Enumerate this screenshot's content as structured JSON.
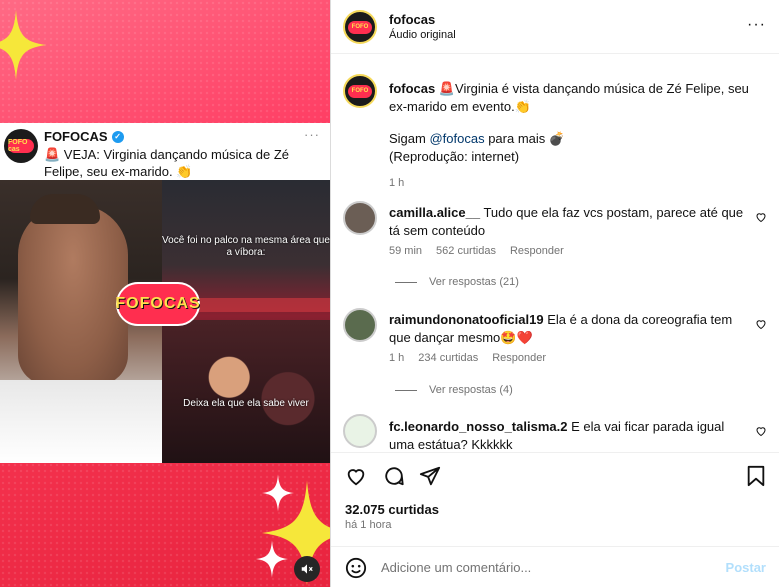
{
  "media": {
    "card": {
      "name": "FOFOCAS",
      "text": "🚨 VEJA: Virginia dançando música de Zé Felipe, seu ex-marido. 👏",
      "more": "···",
      "logo_text": "FOFO cas"
    },
    "overlay_top": "Você foi no palco na mesma área que a víbora:",
    "overlay_bottom": "Deixa ela que ela sabe viver",
    "brand_logo": "FOFOCAS"
  },
  "header": {
    "username": "fofocas",
    "subtitle": "Áudio original",
    "more": "···"
  },
  "caption": {
    "username": "fofocas",
    "text": " 🚨Virginia é vista dançando música de Zé Felipe, seu ex-marido em evento.👏",
    "line2_prefix": "Sigam ",
    "mention": "@fofocas",
    "line2_suffix": " para mais 💣",
    "line3": "(Reprodução: internet)",
    "time": "1 h"
  },
  "comments": [
    {
      "username": "camilla.alice__",
      "text": "Tudo que ela faz vcs postam, parece até que tá sem conteúdo",
      "time": "59 min",
      "likes": "562 curtidas",
      "reply": "Responder",
      "view_replies": "Ver respostas (21)"
    },
    {
      "username": "raimundononatooficial19",
      "text": "Ela é a dona da coreografia tem que dançar mesmo🤩❤️",
      "time": "1 h",
      "likes": "234 curtidas",
      "reply": "Responder",
      "view_replies": "Ver respostas (4)"
    },
    {
      "username": "fc.leonardo_nosso_talisma.2",
      "text": "E ela vai ficar parada igual uma estátua? Kkkkkk"
    }
  ],
  "footer": {
    "likes": "32.075 curtidas",
    "time": "há 1 hora",
    "comment_placeholder": "Adicione um comentário...",
    "post": "Postar"
  }
}
